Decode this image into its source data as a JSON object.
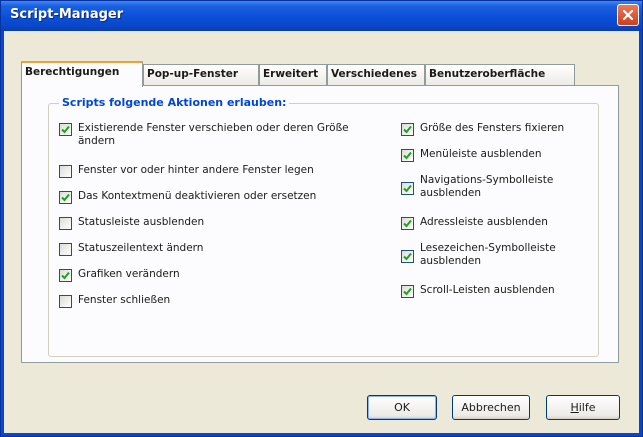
{
  "window": {
    "title": "Script-Manager"
  },
  "tabs": [
    {
      "label": "Berechtigungen",
      "active": true
    },
    {
      "label": "Pop-up-Fenster",
      "active": false
    },
    {
      "label": "Erweitert",
      "active": false
    },
    {
      "label": "Verschiedenes",
      "active": false
    },
    {
      "label": "Benutzeroberfläche",
      "active": false
    }
  ],
  "group": {
    "legend": "Scripts folgende Aktionen erlauben:",
    "left": [
      {
        "label": "Existierende Fenster verschieben oder deren Größe ändern",
        "checked": true
      },
      {
        "label": "Fenster vor oder hinter andere Fenster legen",
        "checked": false
      },
      {
        "label": "Das Kontextmenü deaktivieren oder ersetzen",
        "checked": true
      },
      {
        "label": "Statusleiste ausblenden",
        "checked": false
      },
      {
        "label": "Statuszeilentext ändern",
        "checked": false
      },
      {
        "label": "Grafiken verändern",
        "checked": true
      },
      {
        "label": "Fenster schließen",
        "checked": false
      }
    ],
    "right": [
      {
        "label": "Größe des Fensters fixieren",
        "checked": true
      },
      {
        "label": "Menüleiste ausblenden",
        "checked": true
      },
      {
        "label": "Navigations-Symbolleiste ausblenden",
        "checked": true
      },
      {
        "label": "Adressleiste ausblenden",
        "checked": true
      },
      {
        "label": "Lesezeichen-Symbolleiste ausblenden",
        "checked": true
      },
      {
        "label": "Scroll-Leisten ausblenden",
        "checked": true
      }
    ]
  },
  "buttons": {
    "ok": "OK",
    "cancel": "Abbrechen",
    "help_prefix": "",
    "help_mnemonic": "H",
    "help_suffix": "ilfe"
  },
  "colors": {
    "titlebar": "#0a4fd8",
    "legend": "#0046d5",
    "checkmark": "#21a121",
    "active_tab_accent": "#e8a33a"
  },
  "icons": {
    "close": "close-icon",
    "check": "checkmark-icon"
  }
}
